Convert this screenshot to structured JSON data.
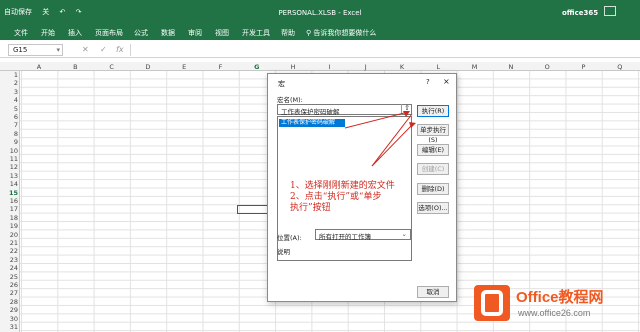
{
  "titlebar": {
    "title": "PERSONAL.XLSB - Excel",
    "account": "office365",
    "qat": [
      "自动保存",
      "关",
      "撤销",
      "重做"
    ]
  },
  "ribbon": {
    "tabs": [
      "文件",
      "开始",
      "插入",
      "页面布局",
      "公式",
      "数据",
      "审阅",
      "视图",
      "开发工具",
      "帮助"
    ],
    "tell_me": "告诉我你想要做什么"
  },
  "formula_bar": {
    "name_box": "G15",
    "fx": "fx"
  },
  "columns": [
    "A",
    "B",
    "C",
    "D",
    "E",
    "F",
    "G",
    "H",
    "I",
    "J",
    "K",
    "L",
    "M",
    "N",
    "O",
    "P",
    "Q"
  ],
  "rows": [
    "1",
    "2",
    "3",
    "4",
    "5",
    "6",
    "7",
    "8",
    "9",
    "10",
    "11",
    "12",
    "13",
    "14",
    "15",
    "16",
    "17",
    "18",
    "19",
    "20",
    "21",
    "22",
    "23",
    "24",
    "25",
    "26",
    "27",
    "28",
    "29",
    "30",
    "31"
  ],
  "selected_cell": {
    "column": "G",
    "row": "15"
  },
  "dialog": {
    "title": "宏",
    "help": "?",
    "close": "×",
    "macro_name_label": "宏名(M):",
    "macro_name_value": "工作表保护密码破解",
    "list_items": [
      "工作表保护密码破解"
    ],
    "annotation": [
      "1、选择刚刚新建的宏文件",
      "2、点击“执行”或“单步",
      "执行”按钮"
    ],
    "buttons": [
      "执行(R)",
      "单步执行(S)",
      "编辑(E)",
      "创建(C)",
      "删除(D)",
      "选项(O)..."
    ],
    "position_label": "位置(A):",
    "position_value": "所有打开的工作簿",
    "description_label": "说明",
    "cancel_label": "取消"
  },
  "watermark": {
    "brand": "Office教程网",
    "url": "www.office26.com"
  },
  "colors": {
    "excel_green": "#217346",
    "annotation_red": "#d0281d",
    "selection_blue": "#0078d7",
    "watermark_orange": "#f05a22"
  }
}
